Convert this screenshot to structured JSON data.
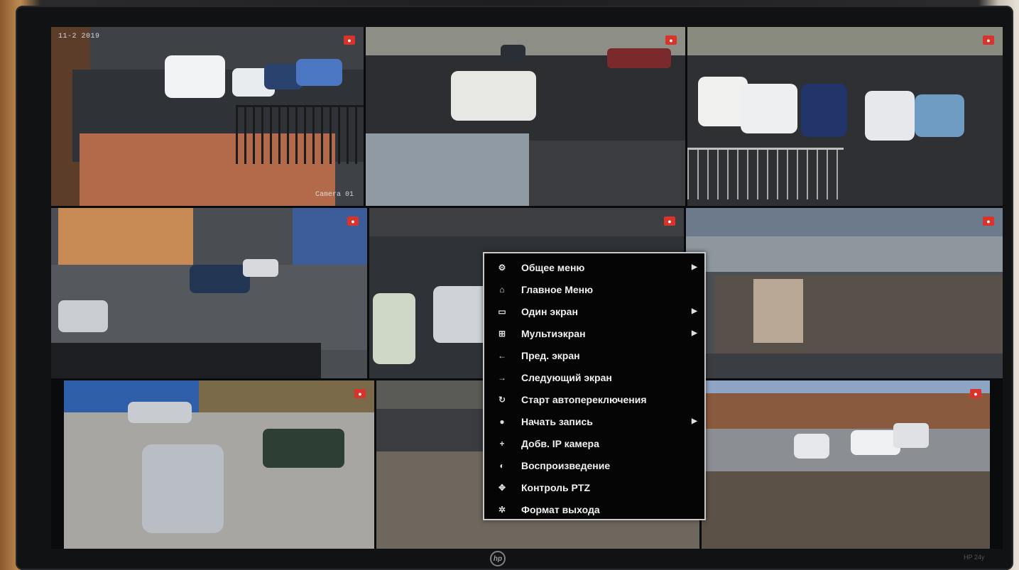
{
  "dvr": {
    "cameras": [
      {
        "timestamp": "11-2   2019",
        "name": "Camera 01"
      },
      {
        "timestamp": "",
        "name": ""
      },
      {
        "timestamp": "",
        "name": ""
      },
      {
        "timestamp": "",
        "name": ""
      },
      {
        "timestamp": "",
        "name": ""
      },
      {
        "timestamp": "",
        "name": ""
      },
      {
        "timestamp": "",
        "name": ""
      },
      {
        "timestamp": "",
        "name": ""
      },
      {
        "timestamp": "",
        "name": ""
      }
    ],
    "context_menu": {
      "items": [
        {
          "label": "Общее меню",
          "icon": "settings-icon",
          "has_submenu": true
        },
        {
          "label": "Главное Меню",
          "icon": "home-icon",
          "has_submenu": false
        },
        {
          "label": "Один экран",
          "icon": "single-screen-icon",
          "has_submenu": true
        },
        {
          "label": "Мультиэкран",
          "icon": "multi-screen-icon",
          "has_submenu": true
        },
        {
          "label": "Пред. экран",
          "icon": "arrow-left-icon",
          "has_submenu": false
        },
        {
          "label": "Следующий экран",
          "icon": "arrow-right-icon",
          "has_submenu": false
        },
        {
          "label": "Старт автопереключения",
          "icon": "cycle-icon",
          "has_submenu": false
        },
        {
          "label": "Начать запись",
          "icon": "record-icon",
          "has_submenu": true
        },
        {
          "label": "Добв. IP камера",
          "icon": "add-camera-icon",
          "has_submenu": false
        },
        {
          "label": "Воспроизведение",
          "icon": "playback-icon",
          "has_submenu": false
        },
        {
          "label": "Контроль PTZ",
          "icon": "ptz-icon",
          "has_submenu": false
        },
        {
          "label": "Формат выхода",
          "icon": "output-icon",
          "has_submenu": false
        }
      ]
    }
  },
  "monitor": {
    "brand": "hp",
    "model": "HP 24y"
  },
  "colors": {
    "rec_badge": "#d9342b",
    "menu_bg": "#050505",
    "menu_border": "#c9c9c9"
  }
}
